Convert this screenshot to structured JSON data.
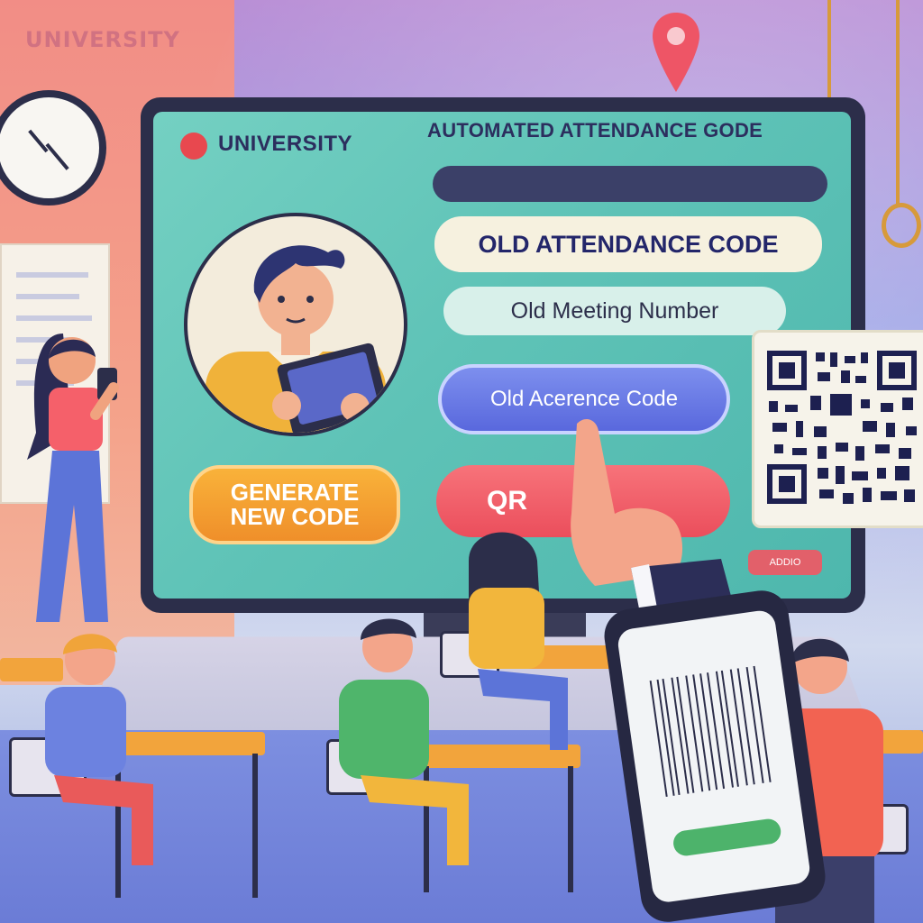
{
  "watermark": "UNIVERSITY",
  "brand": {
    "name": "UNIVERSITY"
  },
  "screen": {
    "title": "AUTOMATED ATTENDANCE GODE",
    "code_title": "OLD ATTENDANCE CODE",
    "meeting_label": "Old Meeting Number",
    "old_code_button": "Old Acerence Code",
    "generate_button_line1": "GENERATE",
    "generate_button_line2": "NEW CODE",
    "qr_button": "QR",
    "small_button": "ADDIO"
  },
  "colors": {
    "screen_bg": "#5fc3b7",
    "brand_dot": "#e8484f",
    "old_code_button": "#6373e2",
    "generate_button": "#f29a2e",
    "qr_button": "#ef5a66",
    "monitor_frame": "#2c2e4a"
  },
  "icons": [
    "map-pin-icon",
    "clock-icon",
    "qr-code-icon",
    "pointing-hand-icon",
    "smartphone-icon"
  ]
}
